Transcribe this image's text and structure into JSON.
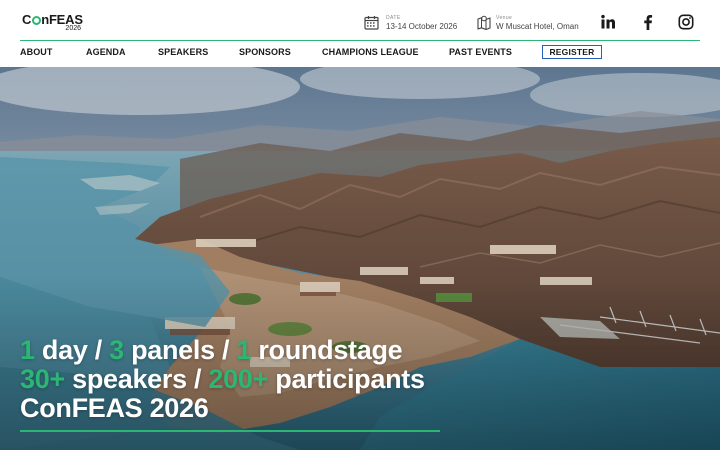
{
  "logo": {
    "name_prefix": "C",
    "name_suffix": "nFEAS",
    "year": "2026"
  },
  "event_info": {
    "date": {
      "label": "DATE",
      "value": "13-14 October 2026",
      "icon": "calendar-icon"
    },
    "venue": {
      "label": "Venue",
      "value": "W Muscat Hotel, Oman",
      "icon": "map-icon"
    }
  },
  "social": [
    {
      "name": "LinkedIn",
      "icon": "linkedin-icon"
    },
    {
      "name": "Facebook",
      "icon": "facebook-icon"
    },
    {
      "name": "Instagram",
      "icon": "instagram-icon"
    }
  ],
  "nav": {
    "items": [
      "ABOUT",
      "AGENDA",
      "SPEAKERS",
      "SPONSORS",
      "CHAMPIONS LEAGUE",
      "PAST EVENTS"
    ],
    "register": "REGISTER"
  },
  "hero": {
    "line1": {
      "n1": "1",
      "t1": " day / ",
      "n2": "3",
      "t2": " panels / ",
      "n3": "1",
      "t3": " roundstage"
    },
    "line2": {
      "n1": "30+",
      "t1": " speakers / ",
      "n2": "200+",
      "t2": " participants"
    },
    "line3": "ConFEAS 2026"
  },
  "colors": {
    "accent": "#2bb673",
    "register_border": "#2a5fb8",
    "text": "#1a1a1a",
    "hero_text": "#ffffff"
  }
}
